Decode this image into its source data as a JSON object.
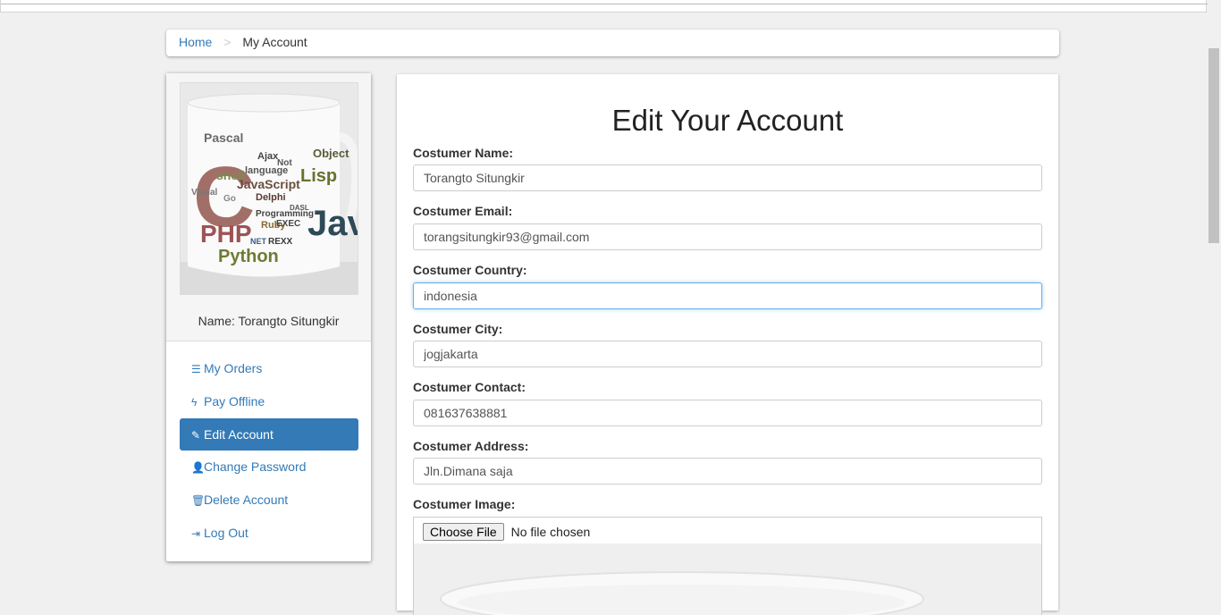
{
  "breadcrumb": {
    "home": "Home",
    "separator": ">",
    "current": "My Account"
  },
  "profile": {
    "name_label": "Name: Torangto Situngkir"
  },
  "sidebar": {
    "items": [
      {
        "icon": "list-icon",
        "glyph": "☰",
        "label": "My Orders",
        "active": false
      },
      {
        "icon": "bolt-icon",
        "glyph": "ϟ",
        "label": "Pay Offline",
        "active": false
      },
      {
        "icon": "pencil-icon",
        "glyph": "✎",
        "label": "Edit Account",
        "active": true
      },
      {
        "icon": "user-icon",
        "glyph": "👤",
        "label": "Change Password",
        "active": false
      },
      {
        "icon": "trash-icon",
        "glyph": "🗑",
        "label": "Delete Account",
        "active": false
      },
      {
        "icon": "sign-out-icon",
        "glyph": "⇥",
        "label": "Log Out",
        "active": false
      }
    ]
  },
  "form": {
    "title": "Edit Your Account",
    "fields": [
      {
        "label": "Costumer Name:",
        "value": "Torangto Situngkir"
      },
      {
        "label": "Costumer Email:",
        "value": "torangsitungkir93@gmail.com"
      },
      {
        "label": "Costumer Country:",
        "value": "indonesia"
      },
      {
        "label": "Costumer City:",
        "value": "jogjakarta"
      },
      {
        "label": "Costumer Contact:",
        "value": "081637638881"
      },
      {
        "label": "Costumer Address:",
        "value": "Jln.Dimana saja"
      }
    ],
    "image_label": "Costumer Image:",
    "file_button": "Choose File",
    "file_status": "No file chosen"
  },
  "mug_words": [
    "Pascal",
    "C",
    "PHP",
    "Python",
    "JavaScript",
    "Lisp",
    "Java",
    "Object",
    "Ajax",
    "Delphi",
    "Ruby",
    "Visual",
    "shell",
    "Go",
    "Programming",
    "REXX",
    "EXEC",
    "DASL",
    "NET",
    "language",
    "Not"
  ],
  "colors": {
    "accent": "#337ab7",
    "link": "#337ab7",
    "focus": "#66afe9"
  }
}
